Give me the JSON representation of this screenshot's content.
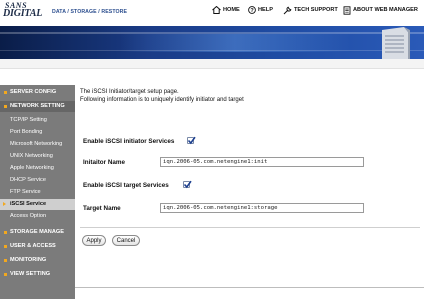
{
  "header": {
    "logo_line1": "SANS",
    "logo_line2": "DIGITAL",
    "breadcrumb": "DATA / STORAGE / RESTORE",
    "nav": [
      {
        "label": "HOME",
        "icon": "home-icon"
      },
      {
        "label": "HELP",
        "icon": "help-icon"
      },
      {
        "label": "TECH SUPPORT",
        "icon": "wrench-icon"
      },
      {
        "label": "ABOUT WEB MANAGER",
        "icon": "document-icon"
      }
    ]
  },
  "sidebar": {
    "items": [
      {
        "label": "SERVER CONFIG",
        "level": "top"
      },
      {
        "label": "NETWORK SETTING",
        "level": "top",
        "expanded": true
      },
      {
        "label": "TCP/IP Setting",
        "level": "sub"
      },
      {
        "label": "Port Bonding",
        "level": "sub"
      },
      {
        "label": "Microsoft Networking",
        "level": "sub"
      },
      {
        "label": "UNIX Networking",
        "level": "sub"
      },
      {
        "label": "Apple Networking",
        "level": "sub"
      },
      {
        "label": "DHCP Service",
        "level": "sub"
      },
      {
        "label": "FTP Service",
        "level": "sub"
      },
      {
        "label": "iSCSI Service",
        "level": "sub",
        "active": true
      },
      {
        "label": "Access Option",
        "level": "sub"
      },
      {
        "label": "STORAGE MANAGE",
        "level": "top"
      },
      {
        "label": "USER & ACCESS",
        "level": "top"
      },
      {
        "label": "MONITORING",
        "level": "top"
      },
      {
        "label": "VIEW SETTING",
        "level": "top"
      }
    ]
  },
  "main": {
    "intro_line1": "The iSCSI Initiator/target setup page.",
    "intro_line2": "Following information is to uniquely identify initiator and target",
    "initiator": {
      "enable_label": "Enable iSCSI initiator Services",
      "enabled": true,
      "name_label": "Initaitor Name",
      "name_value": "iqn.2006-05.com.netengine1:init"
    },
    "target": {
      "enable_label": "Enable iSCSI target Services",
      "enabled": true,
      "name_label": "Target Name",
      "name_value": "iqn.2006-05.com.netengine1:storage"
    },
    "apply_label": "Apply",
    "cancel_label": "Cancel"
  },
  "colors": {
    "sidebar_bg": "#7b7b7b",
    "sidebar_bullet": "#f2a81f",
    "banner": "#1f4ca3",
    "breadcrumb": "#2d4f8f"
  }
}
